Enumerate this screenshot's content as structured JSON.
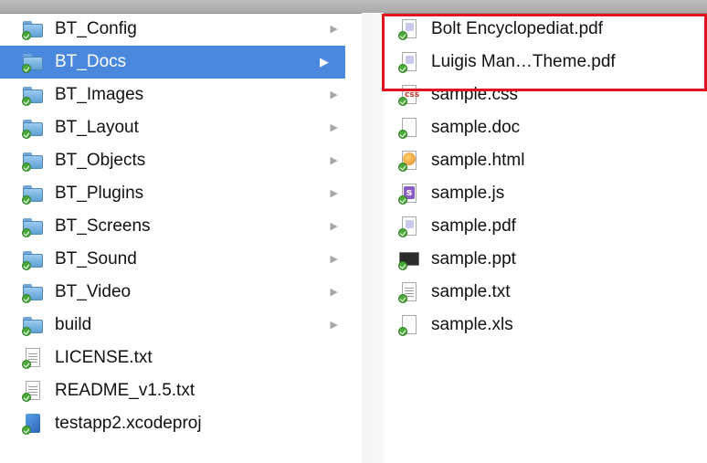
{
  "left_column": {
    "items": [
      {
        "label": "BT_Config",
        "icon": "folder-icon",
        "has_children": true,
        "selected": false
      },
      {
        "label": "BT_Docs",
        "icon": "folder-icon",
        "has_children": true,
        "selected": true
      },
      {
        "label": "BT_Images",
        "icon": "folder-icon",
        "has_children": true,
        "selected": false
      },
      {
        "label": "BT_Layout",
        "icon": "folder-icon",
        "has_children": true,
        "selected": false
      },
      {
        "label": "BT_Objects",
        "icon": "folder-icon",
        "has_children": true,
        "selected": false
      },
      {
        "label": "BT_Plugins",
        "icon": "folder-icon",
        "has_children": true,
        "selected": false
      },
      {
        "label": "BT_Screens",
        "icon": "folder-icon",
        "has_children": true,
        "selected": false
      },
      {
        "label": "BT_Sound",
        "icon": "folder-icon",
        "has_children": true,
        "selected": false
      },
      {
        "label": "BT_Video",
        "icon": "folder-icon",
        "has_children": true,
        "selected": false
      },
      {
        "label": "build",
        "icon": "folder-icon",
        "has_children": true,
        "selected": false
      },
      {
        "label": "LICENSE.txt",
        "icon": "text-file-icon",
        "has_children": false,
        "selected": false
      },
      {
        "label": "README_v1.5.txt",
        "icon": "text-file-icon",
        "has_children": false,
        "selected": false
      },
      {
        "label": "testapp2.xcodeproj",
        "icon": "xcodeproj-icon",
        "has_children": false,
        "selected": false
      }
    ]
  },
  "right_column": {
    "items": [
      {
        "label": "Bolt Encyclopediat.pdf",
        "icon": "pdf-file-icon"
      },
      {
        "label": "Luigis Man…Theme.pdf",
        "icon": "pdf-file-icon"
      },
      {
        "label": "sample.css",
        "icon": "css-file-icon"
      },
      {
        "label": "sample.doc",
        "icon": "doc-file-icon"
      },
      {
        "label": "sample.html",
        "icon": "html-file-icon"
      },
      {
        "label": "sample.js",
        "icon": "js-file-icon"
      },
      {
        "label": "sample.pdf",
        "icon": "pdf-file-icon"
      },
      {
        "label": "sample.ppt",
        "icon": "ppt-file-icon"
      },
      {
        "label": "sample.txt",
        "icon": "text-file-icon"
      },
      {
        "label": "sample.xls",
        "icon": "xls-file-icon"
      }
    ]
  },
  "colors": {
    "selection": "#4a88dd",
    "highlight_box": "#e0141e",
    "sync_badge": "#4caa3a"
  }
}
